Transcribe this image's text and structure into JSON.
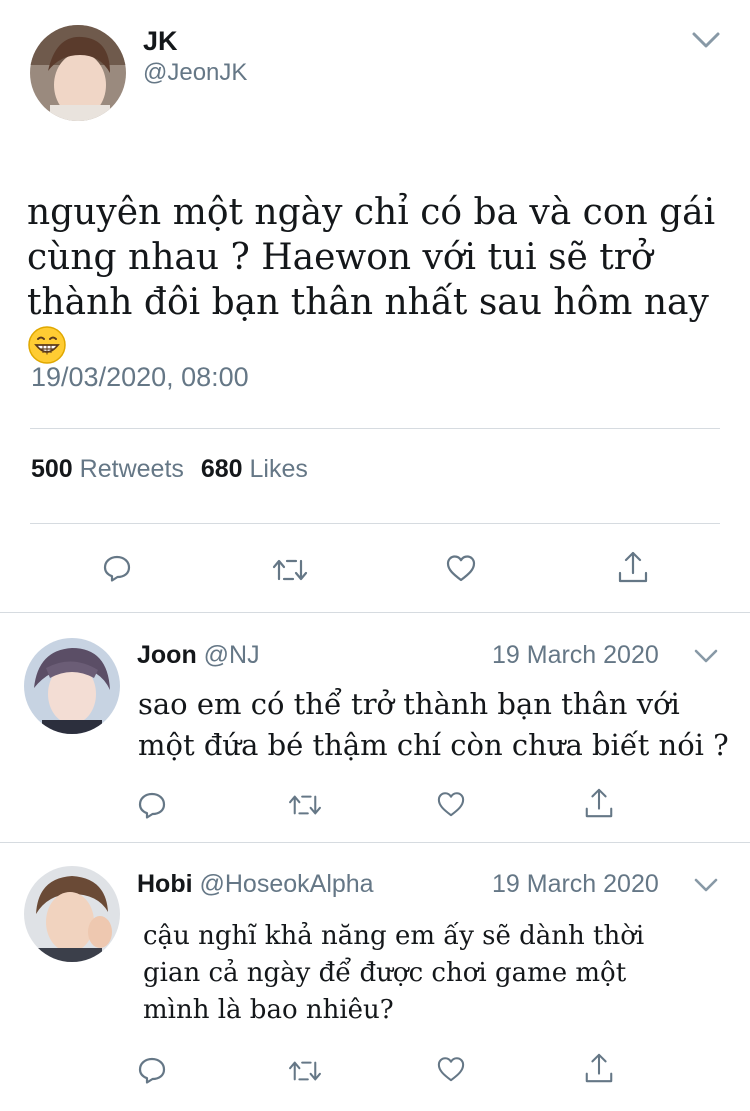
{
  "main_tweet": {
    "author_name": "JK",
    "author_handle": "@JeonJK",
    "text": "nguyên một ngày chỉ có ba và con gái cùng nhau ? Haewon với tui sẽ trở thành đôi bạn thân nhất sau hôm nay",
    "emoji": "grinning-face-emoji",
    "timestamp": "19/03/2020, 08:00",
    "retweets_count": "500",
    "retweets_label": "Retweets",
    "likes_count": "680",
    "likes_label": "Likes"
  },
  "replies": [
    {
      "author_name": "Joon",
      "author_handle": "@NJ",
      "date": "19 March 2020",
      "text": "sao em có thể trở thành bạn thân với một đứa bé thậm chí còn chưa biết nói ?"
    },
    {
      "author_name": "Hobi",
      "author_handle": "@HoseokAlpha",
      "date": "19 March 2020",
      "text": "cậu nghĩ khả năng em ấy sẽ dành thời gian cả ngày để được chơi game một mình là bao nhiêu?"
    }
  ],
  "colors": {
    "text": "#14171a",
    "secondary": "#657786",
    "divider": "#d6dbe0"
  },
  "icons": [
    "reply-icon",
    "retweet-icon",
    "like-icon",
    "share-icon",
    "chevron-down-icon"
  ]
}
